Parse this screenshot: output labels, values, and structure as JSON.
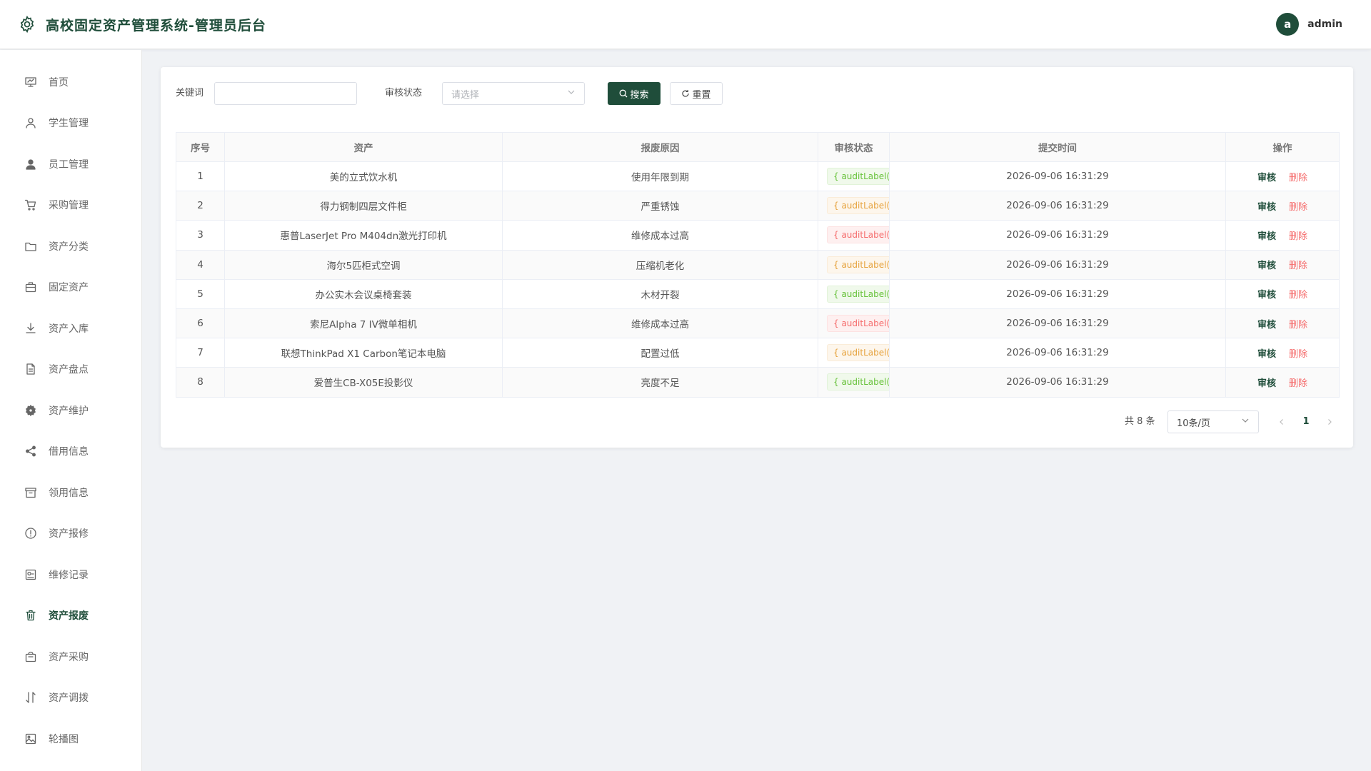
{
  "header": {
    "title": "高校固定资产管理系统-管理员后台",
    "avatar_letter": "a",
    "username": "admin"
  },
  "sidebar": {
    "items": [
      {
        "label": "首页",
        "icon": "chart-board-icon"
      },
      {
        "label": "学生管理",
        "icon": "user-outline-icon"
      },
      {
        "label": "员工管理",
        "icon": "user-filled-icon"
      },
      {
        "label": "采购管理",
        "icon": "cart-icon"
      },
      {
        "label": "资产分类",
        "icon": "folder-icon"
      },
      {
        "label": "固定资产",
        "icon": "briefcase-icon"
      },
      {
        "label": "资产入库",
        "icon": "download-icon"
      },
      {
        "label": "资产盘点",
        "icon": "document-icon"
      },
      {
        "label": "资产维护",
        "icon": "gear-icon"
      },
      {
        "label": "借用信息",
        "icon": "share-icon"
      },
      {
        "label": "领用信息",
        "icon": "box-icon"
      },
      {
        "label": "资产报修",
        "icon": "warning-circle-icon"
      },
      {
        "label": "维修记录",
        "icon": "record-icon"
      },
      {
        "label": "资产报废",
        "icon": "trash-icon"
      },
      {
        "label": "资产采购",
        "icon": "bag-icon"
      },
      {
        "label": "资产调拨",
        "icon": "transfer-icon"
      },
      {
        "label": "轮播图",
        "icon": "picture-icon"
      }
    ],
    "active_index": 13
  },
  "search": {
    "keyword_label": "关键词",
    "keyword_value": "",
    "status_label": "审核状态",
    "status_placeholder": "请选择",
    "search_button": "搜索",
    "reset_button": "重置"
  },
  "table": {
    "columns": [
      "序号",
      "资产",
      "报废原因",
      "审核状态",
      "提交时间",
      "操作"
    ],
    "rows": [
      {
        "index": "1",
        "asset": "美的立式饮水机",
        "reason": "使用年限到期",
        "status": "{ auditLabel(ro",
        "status_color": "green",
        "time": "2026-09-06 16:31:29"
      },
      {
        "index": "2",
        "asset": "得力钢制四层文件柜",
        "reason": "严重锈蚀",
        "status": "{ auditLabel(ro",
        "status_color": "orange",
        "time": "2026-09-06 16:31:29"
      },
      {
        "index": "3",
        "asset": "惠普LaserJet Pro M404dn激光打印机",
        "reason": "维修成本过高",
        "status": "{ auditLabel(ro",
        "status_color": "red",
        "time": "2026-09-06 16:31:29"
      },
      {
        "index": "4",
        "asset": "海尔5匹柜式空调",
        "reason": "压缩机老化",
        "status": "{ auditLabel(ro",
        "status_color": "orange",
        "time": "2026-09-06 16:31:29"
      },
      {
        "index": "5",
        "asset": "办公实木会议桌椅套装",
        "reason": "木材开裂",
        "status": "{ auditLabel(ro",
        "status_color": "green",
        "time": "2026-09-06 16:31:29"
      },
      {
        "index": "6",
        "asset": "索尼Alpha 7 IV微单相机",
        "reason": "维修成本过高",
        "status": "{ auditLabel(ro",
        "status_color": "red",
        "time": "2026-09-06 16:31:29"
      },
      {
        "index": "7",
        "asset": "联想ThinkPad X1 Carbon笔记本电脑",
        "reason": "配置过低",
        "status": "{ auditLabel(ro",
        "status_color": "orange",
        "time": "2026-09-06 16:31:29"
      },
      {
        "index": "8",
        "asset": "爱普生CB-X05E投影仪",
        "reason": "亮度不足",
        "status": "{ auditLabel(ro",
        "status_color": "green",
        "time": "2026-09-06 16:31:29"
      }
    ],
    "action_audit": "审核",
    "action_delete": "删除"
  },
  "pagination": {
    "total_text": "共 8 条",
    "page_size": "10条/页",
    "current_page": "1"
  },
  "colors": {
    "primary": "#1f4d3a",
    "danger": "#f56c6c",
    "success": "#67c23a",
    "warning": "#e6a23c"
  }
}
